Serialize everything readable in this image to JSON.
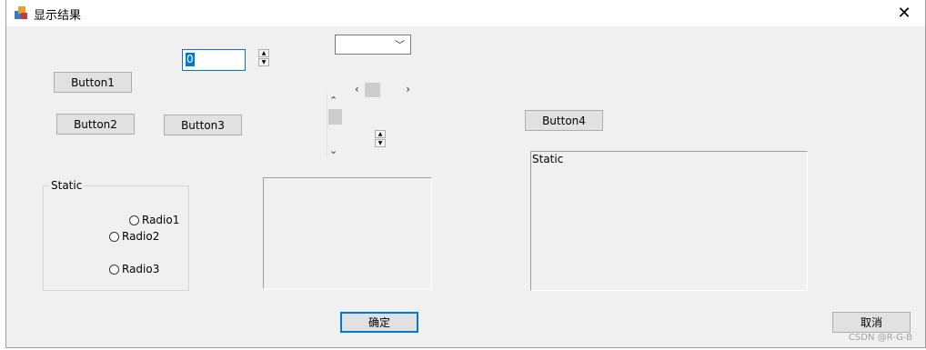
{
  "window": {
    "title": "显示结果",
    "close_symbol": "✕"
  },
  "edit": {
    "value": "0"
  },
  "combo": {
    "value": ""
  },
  "buttons": {
    "b1": "Button1",
    "b2": "Button2",
    "b3": "Button3",
    "b4": "Button4",
    "ok": "确定",
    "cancel": "取消"
  },
  "group": {
    "label": "Static",
    "radios": [
      "Radio1",
      "Radio2",
      "Radio3"
    ]
  },
  "static_box": {
    "label": "Static"
  },
  "watermark": "CSDN @R-G-B"
}
